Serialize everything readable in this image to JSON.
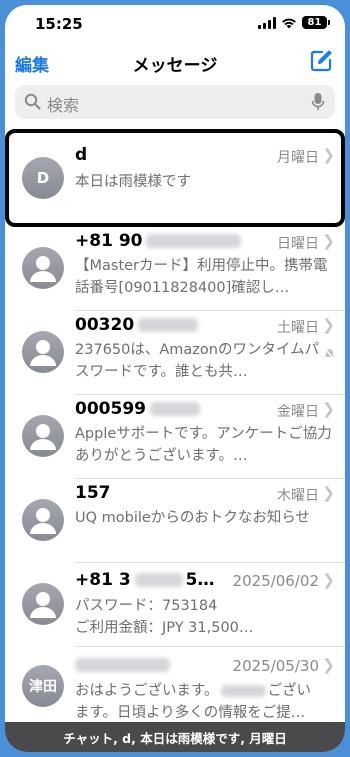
{
  "status": {
    "time": "15:25",
    "battery": "81"
  },
  "nav": {
    "edit_label": "編集",
    "title": "メッセージ"
  },
  "search": {
    "placeholder": "検索"
  },
  "conversations": [
    {
      "avatar": "D",
      "name": "d",
      "date": "月曜日",
      "preview": "本日は雨模様です"
    },
    {
      "avatar": "",
      "name": "+81 90",
      "date": "日曜日",
      "preview": "【Masterカード】利用停止中。携帯電話番号[09011828400]確認し…"
    },
    {
      "avatar": "",
      "name": "00320",
      "date": "土曜日",
      "preview": "237650は、Amazonのワンタイムパスワードです。誰とも共…"
    },
    {
      "avatar": "",
      "name": "000599",
      "date": "金曜日",
      "preview": "Appleサポートです。アンケートご協力ありがとうございます。…"
    },
    {
      "avatar": "",
      "name": "157",
      "date": "木曜日",
      "preview": "UQ mobileからのおトクなお知らせ"
    },
    {
      "avatar": "",
      "name": "+81 3",
      "name_suffix": "5…",
      "date": "2025/06/02",
      "preview": "パスワード：753184",
      "preview2": "ご利用金額：JPY 31,500…"
    },
    {
      "avatar": "津田",
      "name": "",
      "date": "2025/05/30",
      "preview": "おはようございます。",
      "preview_tail": "ござい",
      "preview2": "ます。日頃より多くの情報をご提…"
    }
  ],
  "caption": "チャット, d, 本日は雨模様です, 月曜日"
}
